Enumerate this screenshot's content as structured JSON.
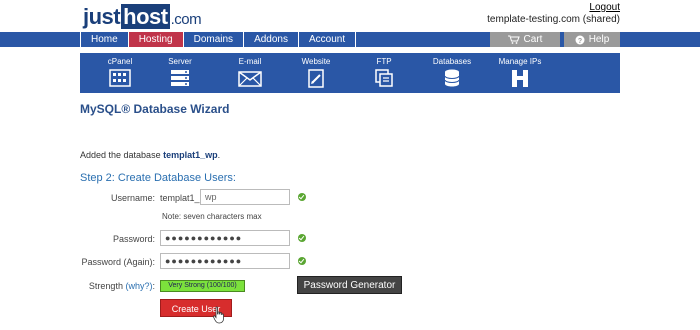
{
  "header": {
    "logo": {
      "just": "just",
      "host": "host",
      "com": ".com"
    },
    "logout": "Logout",
    "account_domain": "template-testing.com (shared)"
  },
  "topnav": {
    "items": [
      {
        "label": "Home",
        "active": false
      },
      {
        "label": "Hosting",
        "active": true
      },
      {
        "label": "Domains",
        "active": false
      },
      {
        "label": "Addons",
        "active": false
      },
      {
        "label": "Account",
        "active": false
      }
    ],
    "cart_label": "Cart",
    "help_label": "Help"
  },
  "toolbar": {
    "items": [
      {
        "label": "cPanel",
        "icon": "cpanel-icon"
      },
      {
        "label": "Server",
        "icon": "server-icon"
      },
      {
        "label": "E-mail",
        "icon": "email-icon"
      },
      {
        "label": "Website",
        "icon": "website-icon"
      },
      {
        "label": "FTP",
        "icon": "ftp-icon"
      },
      {
        "label": "Databases",
        "icon": "databases-icon"
      },
      {
        "label": "Manage IPs",
        "icon": "manage-ips-icon"
      }
    ]
  },
  "main": {
    "page_title": "MySQL® Database Wizard",
    "added_prefix": "Added the database ",
    "added_db": "templat1_wp",
    "added_suffix": ".",
    "step_title": "Step 2: Create Database Users:",
    "username_label": "Username:",
    "username_prefix": "templat1_",
    "username_value": "wp",
    "username_note": "Note: seven characters max",
    "password_label": "Password:",
    "password_value": "●●●●●●●●●●●●",
    "password_again_label": "Password (Again):",
    "password_again_value": "●●●●●●●●●●●●",
    "strength_label": "Strength",
    "strength_why": "(why?)",
    "strength_colon": ":",
    "strength_value": "Very Strong (100/100)",
    "password_generator_label": "Password Generator",
    "create_user_label": "Create User"
  },
  "colors": {
    "nav_blue": "#2a57a6",
    "active_tab": "#c0344a",
    "create_button": "#d72d2d",
    "strength_bar": "#7ce23c",
    "check_green": "#5aa632"
  }
}
